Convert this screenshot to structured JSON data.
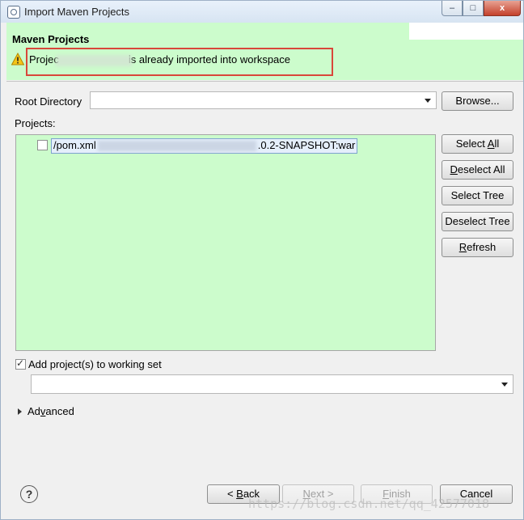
{
  "window": {
    "title": "Import Maven Projects",
    "controls": {
      "minimize": "–",
      "maximize": "□",
      "close": "x"
    }
  },
  "header": {
    "title": "Maven Projects",
    "message_prefix": "Projec",
    "message_suffix": "is already imported into workspace",
    "warning_color": "#e8b100"
  },
  "form": {
    "root_directory_label": "Root Directory",
    "browse_label": "Browse...",
    "projects_label": "Projects:"
  },
  "projects": [
    {
      "prefix": "/pom.xml",
      "suffix": ".0.2-SNAPSHOT:war",
      "checked": false
    }
  ],
  "side_buttons": {
    "select_all": "Select All",
    "deselect_all": "Deselect All",
    "select_tree": "Select Tree",
    "deselect_tree": "Deselect Tree",
    "refresh": "Refresh"
  },
  "working_set": {
    "label": "Add project(s) to working set",
    "checked": true
  },
  "advanced_label": "Advanced",
  "footer": {
    "help": "?",
    "back": "< Back",
    "next": "Next >",
    "finish": "Finish",
    "cancel": "Cancel"
  },
  "watermark": "https://blog.csdn.net/qq_42577018"
}
